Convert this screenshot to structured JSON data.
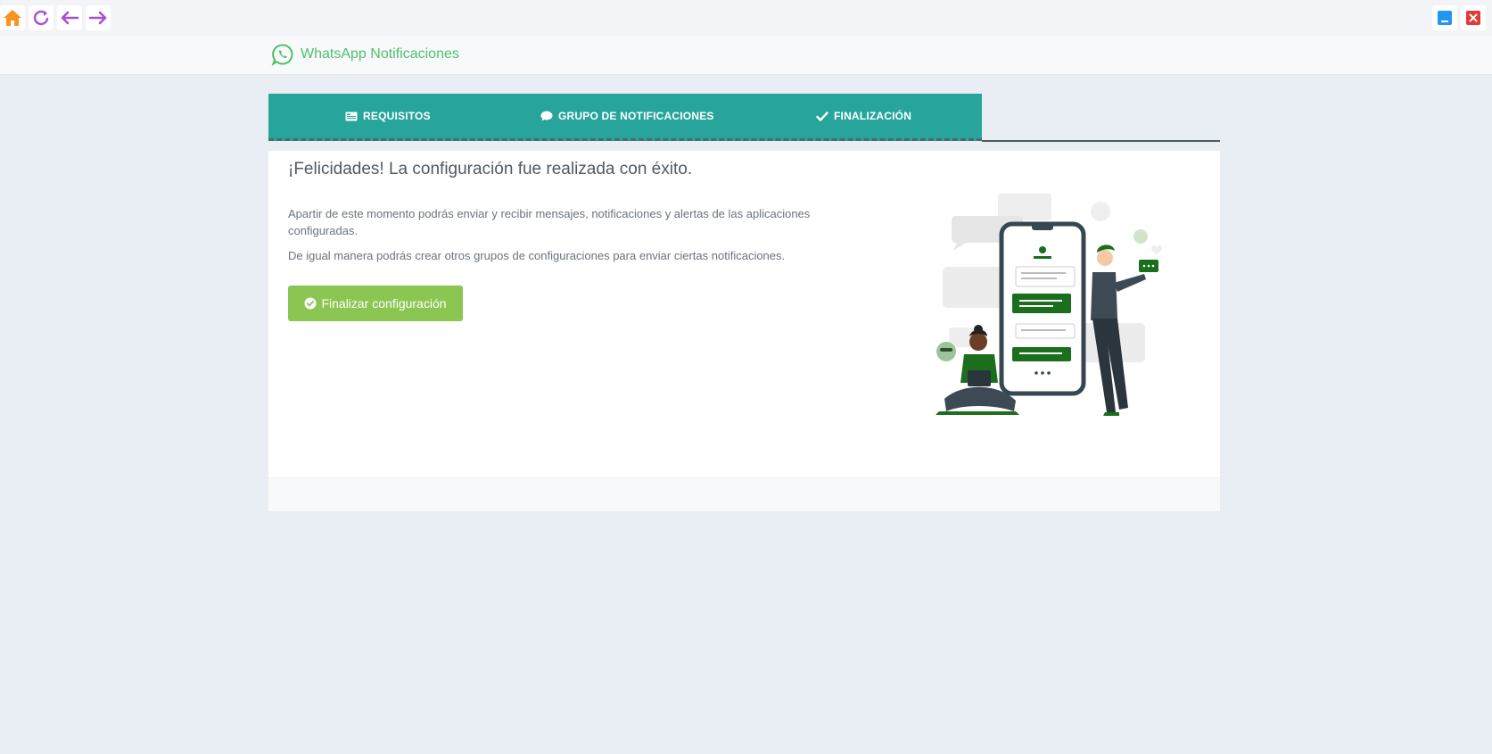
{
  "topbar": {
    "buttons": [
      "home-icon",
      "refresh-icon",
      "back-arrow-icon",
      "forward-arrow-icon"
    ],
    "window_controls": [
      "minimize-icon",
      "close-icon"
    ]
  },
  "app": {
    "title": "WhatsApp Notificaciones",
    "brand_color": "#4fc06a"
  },
  "tabs": [
    {
      "label": "REQUISITOS",
      "icon": "id-card-icon"
    },
    {
      "label": "GRUPO DE NOTIFICACIONES",
      "icon": "comment-icon"
    },
    {
      "label": "FINALIZACIÓN",
      "icon": "check-icon"
    }
  ],
  "tabs_color": "#27a59b",
  "content": {
    "heading": "¡Felicidades! La configuración fue realizada con éxito.",
    "paragraph1": "Apartir de este momento podrás enviar y recibir mensajes, notificaciones y alertas de las aplicaciones configuradas.",
    "paragraph2": "De igual manera podrás crear otros grupos de configuraciones para enviar ciertas notificaciones.",
    "finish_button": {
      "label": "Finalizar configuración",
      "icon": "check-circle-icon",
      "color": "#8bc552"
    }
  },
  "illustration": "people-chatting-illustration"
}
